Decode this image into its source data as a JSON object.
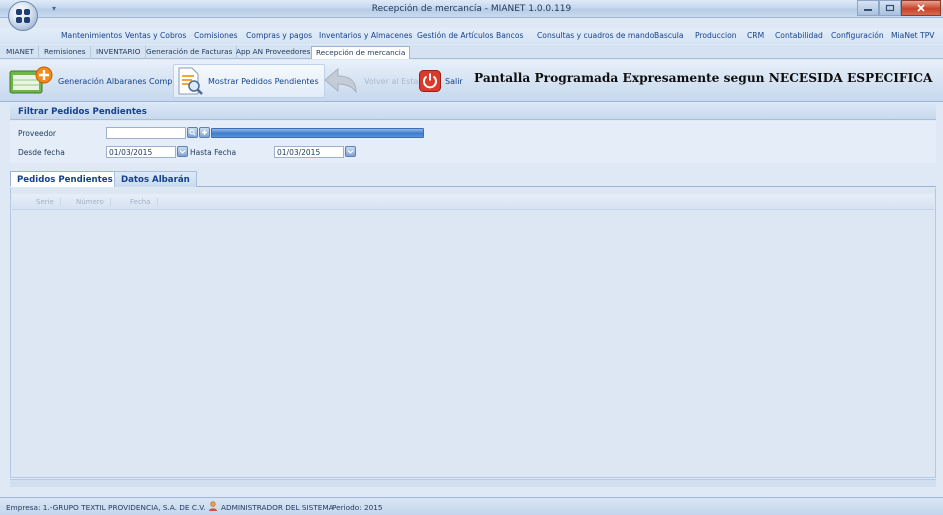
{
  "window": {
    "title": "Recepción de mercancía - MIANET 1.0.0.119",
    "qat_glyph": "▾"
  },
  "menu": {
    "items": [
      "Mantenimientos",
      "Ventas y Cobros",
      "Comisiones",
      "Compras y pagos",
      "Inventarios y Almacenes",
      "Gestión de Artículos",
      "Bancos",
      "Consultas y cuadros de mando",
      "Bascula",
      "Produccion",
      "CRM",
      "Contabilidad",
      "Configuración",
      "MiaNet TPV"
    ]
  },
  "doc_tabs": {
    "items": [
      "MIANET",
      "Remisiones",
      "INVENTARIO",
      "Generación de Facturas",
      "App AN Proveedores",
      "Recepción de mercancia"
    ],
    "active_index": 5
  },
  "ribbon": {
    "gen_albaranes": "Generación Albaranes Compra",
    "mostrar_pedidos": "Mostrar Pedidos Pendientes",
    "disabled_label": "Volver al Estado",
    "salir": "Salir",
    "message": "Pantalla Programada Expresamente segun NECESIDA ESPECIFICA"
  },
  "filter": {
    "header": "Filtrar Pedidos Pendientes",
    "proveedor_label": "Proveedor",
    "proveedor_value": "",
    "desde_label": "Desde fecha",
    "desde_value": "01/03/2015",
    "hasta_label": "Hasta Fecha",
    "hasta_value": "01/03/2015"
  },
  "tabs": {
    "pedidos": "Pedidos Pendientes",
    "datos": "Datos Albarán"
  },
  "grid": {
    "columns": [
      "Serie",
      "Número",
      "Fecha"
    ]
  },
  "status": {
    "empresa": "Empresa: 1.-GRUPO TEXTIL PROVIDENCIA, S.A.  DE C.V.",
    "usuario": "ADMINISTRADOR DEL SISTEMA",
    "periodo": "Periodo: 2015"
  },
  "colors": {
    "accent": "#15428b",
    "salir_red": "#d83b2b",
    "add_orange": "#f08c1a",
    "sheet_green": "#6fb64a"
  }
}
